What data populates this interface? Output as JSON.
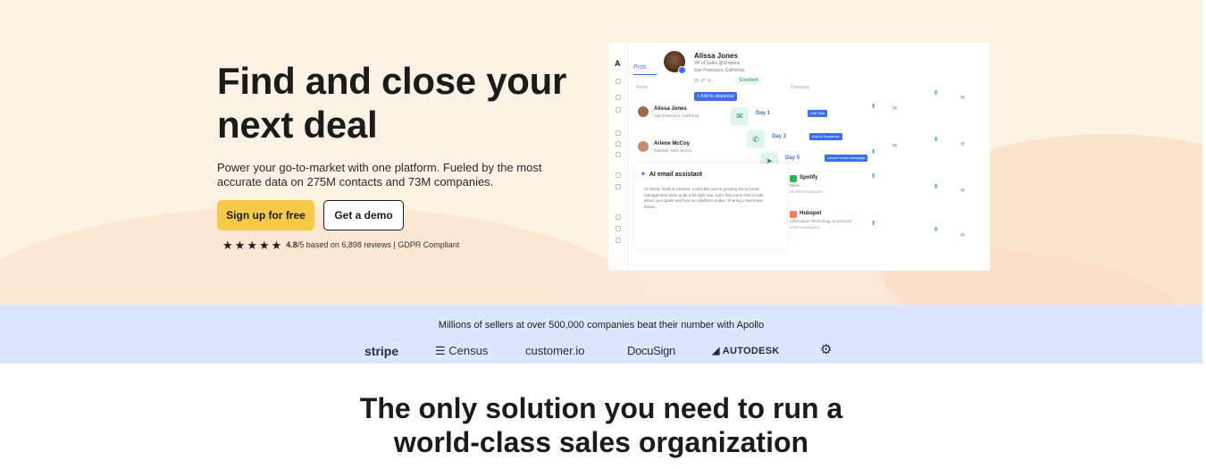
{
  "hero": {
    "title": "Find and close your next deal",
    "subtitle": "Power your go-to-market with one platform. Fueled by the most accurate data on 275M contacts and 73M companies.",
    "cta_primary": "Sign up for free",
    "cta_secondary": "Get a demo",
    "rating_score": "4.8",
    "rating_rest": "/5 based on 6,898 reviews | GDPR Compliant",
    "stars": 5
  },
  "mock": {
    "logo": "A",
    "tab": "Pros",
    "col_name": "Name",
    "col_company": "Company",
    "profile": {
      "name": "Alissa Jones",
      "title": "VP of Sales @Dropbox",
      "location": "San Francisco, California",
      "score": "Excellent"
    },
    "sequence_button": "+ Add to sequence",
    "contacts": [
      {
        "name": "Alissa Jones",
        "location": "San Francisco, California"
      },
      {
        "name": "Arlene McCoy",
        "location": "Oakville, New Jersey"
      }
    ],
    "steps": [
      {
        "label": "Day 1",
        "tag": "Add Task"
      },
      {
        "label": "Day 3",
        "tag": "Add to Sequence"
      },
      {
        "label": "Day 5",
        "tag": "Launch email campaign"
      }
    ],
    "ai": {
      "title": "AI email assistant",
      "body": "Hi Alissa, Glad to connect. Looks like you're growing the account management team quite a bit right now. Let's find some time to talk about your goals and how our platform scales. Sharing a few times below..."
    },
    "companies": [
      {
        "name": "Spotify",
        "industry": "Music",
        "size": "15,000 employees"
      },
      {
        "name": "Hubspot",
        "industry": "Information Technology & Services",
        "size": "5700 employees"
      }
    ]
  },
  "band": {
    "text": "Millions of sellers at over 500,000 companies beat their number with Apollo",
    "logos": [
      "stripe",
      "Census",
      "customer.io",
      "DocuSign",
      "AUTODESK"
    ]
  },
  "section": {
    "title_line1": "The only solution you need to run a",
    "title_line2": "world-class sales organization"
  },
  "colors": {
    "hero_bg": "#fdf3e4",
    "accent_yellow": "#f7c948",
    "band_bg": "#dbe7fc",
    "mock_blue": "#3b6cf6"
  }
}
